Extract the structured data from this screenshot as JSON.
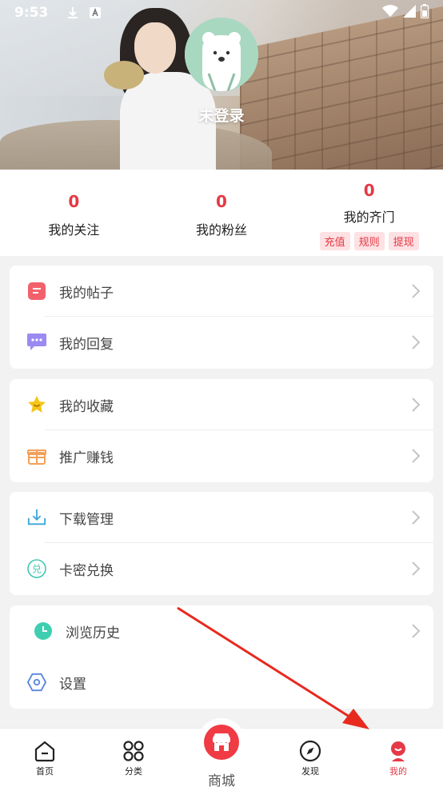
{
  "statusbar": {
    "time": "9:53",
    "icons": [
      "download-icon",
      "a-icon",
      "wifi-icon",
      "signal-icon",
      "battery-icon"
    ]
  },
  "profile": {
    "login_label": "未登录"
  },
  "stats": [
    {
      "value": "0",
      "label": "我的关注"
    },
    {
      "value": "0",
      "label": "我的粉丝"
    },
    {
      "value": "0",
      "label": "我的齐门",
      "tags": [
        "充值",
        "规则",
        "提现"
      ]
    }
  ],
  "menu": {
    "group1": [
      {
        "label": "我的帖子",
        "icon": "post-icon"
      },
      {
        "label": "我的回复",
        "icon": "reply-icon"
      }
    ],
    "group2": [
      {
        "label": "我的收藏",
        "icon": "star-icon"
      },
      {
        "label": "推广赚钱",
        "icon": "gift-icon"
      }
    ],
    "group3": [
      {
        "label": "下载管理",
        "icon": "download-tray-icon"
      },
      {
        "label": "卡密兑换",
        "icon": "exchange-icon"
      }
    ],
    "group4": [
      {
        "label": "浏览历史",
        "icon": "clock-icon"
      },
      {
        "label": "设置",
        "icon": "hexagon-settings-icon"
      }
    ]
  },
  "nav": {
    "home": "首页",
    "category": "分类",
    "mall": "商城",
    "discover": "发现",
    "mine": "我的"
  },
  "colors": {
    "accent": "#e53945",
    "tag_bg": "#fde1e3"
  }
}
